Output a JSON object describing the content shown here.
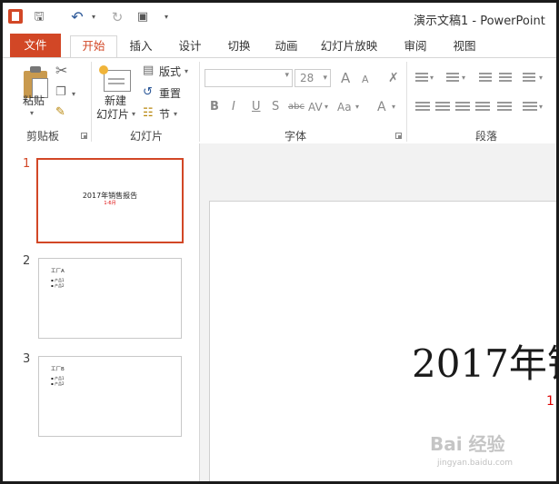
{
  "app": {
    "window_title": "演示文稿1 - PowerPoint",
    "accent_color": "#d24726"
  },
  "quick_access": {
    "icons": [
      "powerpoint-logo-icon",
      "save-icon",
      "undo-icon",
      "redo-icon",
      "start-presentation-icon",
      "customize-qat-icon"
    ]
  },
  "tabs": [
    {
      "label": "文件",
      "active": false
    },
    {
      "label": "开始",
      "active": true
    },
    {
      "label": "插入",
      "active": false
    },
    {
      "label": "设计",
      "active": false
    },
    {
      "label": "切换",
      "active": false
    },
    {
      "label": "动画",
      "active": false
    },
    {
      "label": "幻灯片放映",
      "active": false
    },
    {
      "label": "审阅",
      "active": false
    },
    {
      "label": "视图",
      "active": false
    }
  ],
  "ribbon": {
    "clipboard": {
      "group_label": "剪贴板",
      "paste_label": "粘贴"
    },
    "slides": {
      "group_label": "幻灯片",
      "new_slide_label_line1": "新建",
      "new_slide_label_line2": "幻灯片",
      "layout_label": "版式",
      "reset_label": "重置",
      "section_label": "节"
    },
    "font": {
      "group_label": "字体",
      "font_name_value": "",
      "font_size_value": "28",
      "grow_font": "A",
      "shrink_font": "A",
      "bold": "B",
      "italic": "I",
      "underline": "U",
      "shadow": "S",
      "strikethrough": "abc",
      "spacing": "AV",
      "change_case": "Aa",
      "font_color": "A"
    },
    "paragraph": {
      "group_label": "段落"
    }
  },
  "slides": [
    {
      "number": "1",
      "title": "2017年销售报告",
      "subtitle": "1-6月",
      "active": true
    },
    {
      "number": "2",
      "heading": "工厂A",
      "bullets": [
        "▪ 产品1",
        "▪ 产品2"
      ],
      "active": false
    },
    {
      "number": "3",
      "heading": "工厂B",
      "bullets": [
        "▪ 产品1",
        "▪ 产品2"
      ],
      "active": false
    }
  ],
  "editor": {
    "title_text": "2017年销",
    "subtitle_text": "1"
  },
  "watermark": {
    "brand": "Bai 经验",
    "url": "jingyan.baidu.com"
  }
}
